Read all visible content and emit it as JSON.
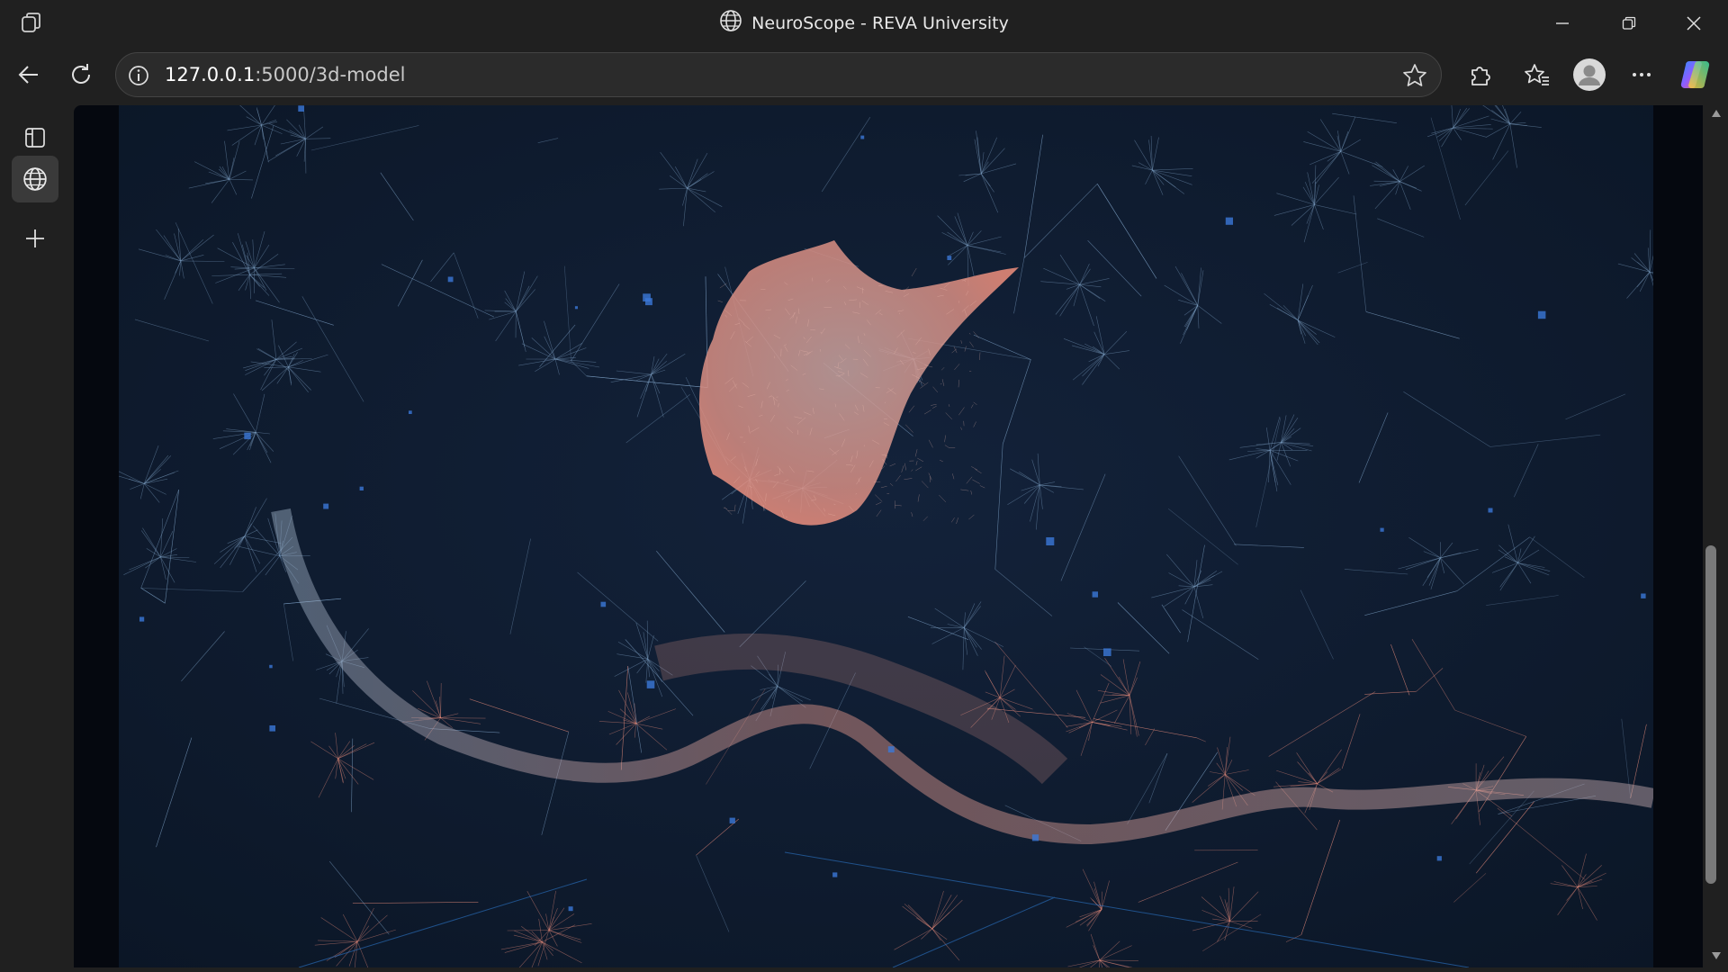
{
  "window": {
    "title": "NeuroScope - REVA University"
  },
  "toolbar": {
    "url_host": "127.0.0.1",
    "url_path": ":5000/3d-model"
  },
  "icons": {
    "app": "workspaces-icon",
    "site": "globe-icon",
    "back": "back-arrow-icon",
    "reload": "reload-icon",
    "info": "info-icon",
    "favorite": "star-icon",
    "extensions": "puzzle-icon",
    "favorites": "favorites-icon",
    "profile": "profile-avatar-icon",
    "more": "more-icon",
    "copilot": "copilot-icon"
  },
  "colors": {
    "chrome": "#202020",
    "scene_bg": "#0e1a2c",
    "mesh_blue": "#7fa3c8",
    "mesh_coral": "#f0907e"
  }
}
